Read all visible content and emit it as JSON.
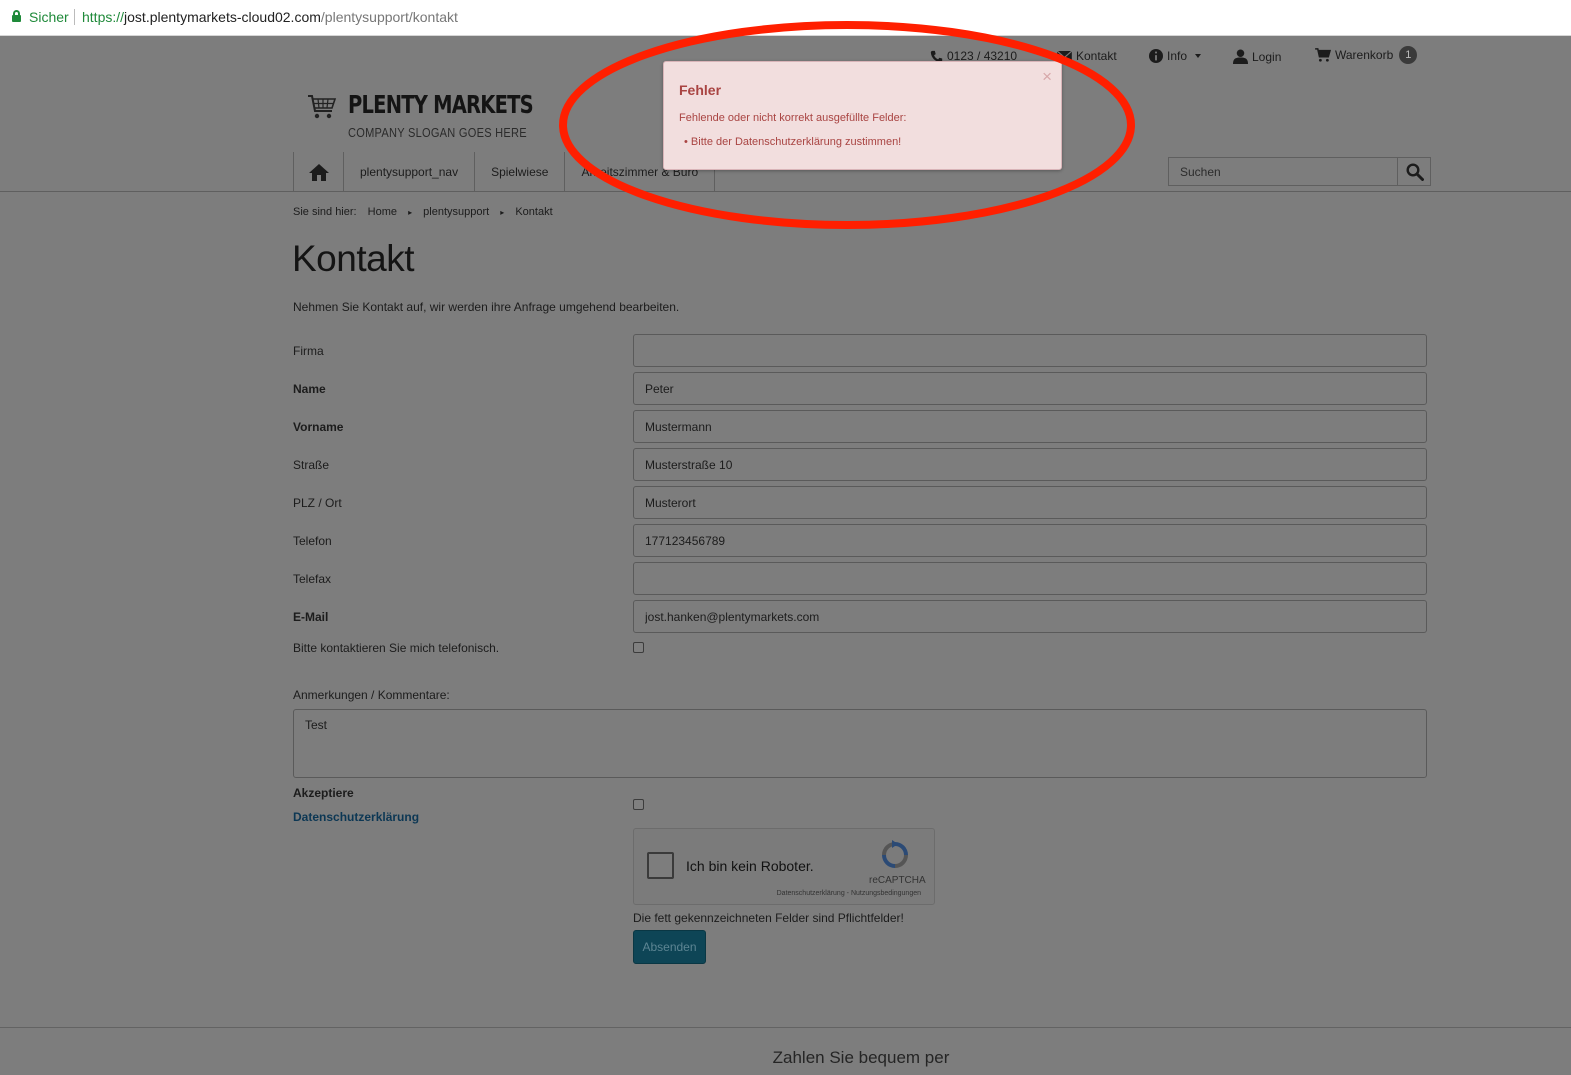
{
  "browser": {
    "secure_label": "Sicher",
    "url_scheme": "https://",
    "url_host": "jost.plentymarkets-cloud02.com",
    "url_path": "/plentysupport/kontakt"
  },
  "topbar": {
    "phone": "0123 / 43210",
    "contact": "Kontakt",
    "info": "Info",
    "login": "Login",
    "cart": "Warenkorb",
    "cart_count": "1"
  },
  "logo": {
    "name": "PLENTY MARKETS",
    "slogan": "COMPANY SLOGAN GOES HERE"
  },
  "nav": {
    "items": [
      "plentysupport_nav",
      "Spielwiese",
      "Arbeitszimmer & Büro"
    ]
  },
  "search": {
    "placeholder": "Suchen"
  },
  "breadcrumb": {
    "prefix": "Sie sind hier:",
    "items": [
      "Home",
      "plentysupport",
      "Kontakt"
    ]
  },
  "page": {
    "title": "Kontakt",
    "intro": "Nehmen Sie Kontakt auf, wir werden ihre Anfrage umgehend bearbeiten."
  },
  "form": {
    "firma_label": "Firma",
    "firma_value": "",
    "name_label": "Name",
    "name_value": "Peter",
    "vorname_label": "Vorname",
    "vorname_value": "Mustermann",
    "strasse_label": "Straße",
    "strasse_value": "Musterstraße 10",
    "plz_label": "PLZ / Ort",
    "plz_value": "Musterort",
    "telefon_label": "Telefon",
    "telefon_value": "177123456789",
    "telefax_label": "Telefax",
    "telefax_value": "",
    "email_label": "E-Mail",
    "email_value": "jost.hanken@plentymarkets.com",
    "callback_label": "Bitte kontaktieren Sie mich telefonisch.",
    "comments_label": "Anmerkungen / Kommentare:",
    "comments_value": "Test",
    "accept_label": "Akzeptiere",
    "privacy_link": "Datenschutzerklärung",
    "required_note": "Die fett gekennzeichneten Felder sind Pflichtfelder!",
    "submit_label": "Absenden"
  },
  "recaptcha": {
    "label": "Ich bin kein Roboter.",
    "brand": "reCAPTCHA",
    "terms": "Datenschutzerklärung - Nutzungsbedingungen"
  },
  "footer": {
    "payment_heading": "Zahlen Sie bequem per"
  },
  "error_dialog": {
    "title": "Fehler",
    "close": "×",
    "message": "Fehlende oder nicht korrekt ausgefüllte Felder:",
    "items": [
      "Bitte der Datenschutzerklärung zustimmen!"
    ]
  },
  "colors": {
    "annotation": "#ff1f00",
    "error_text": "#a94442",
    "error_bg": "#f2dede"
  }
}
